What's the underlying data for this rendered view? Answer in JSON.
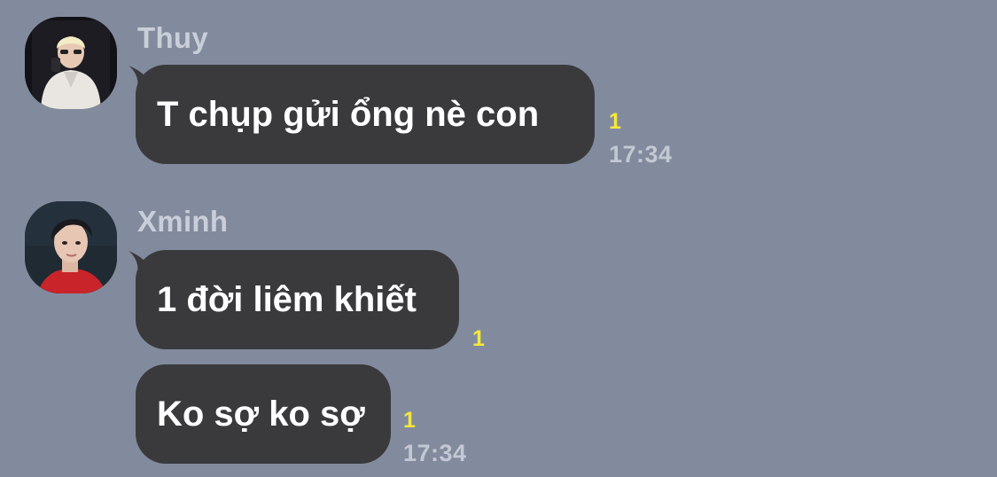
{
  "theme": {
    "background": "#828b9d",
    "bubble": "#3a3a3d",
    "unread_color": "#f4e83a"
  },
  "messages": [
    {
      "sender": "Thuy",
      "avatar_icon": "person-photo-avatar",
      "items": [
        {
          "text": "T chụp gửi ổng nè con",
          "unread": "1",
          "time": "17:34"
        }
      ]
    },
    {
      "sender": "Xminh",
      "avatar_icon": "person-photo-avatar",
      "items": [
        {
          "text": "1 đời liêm khiết",
          "unread": "1",
          "time": ""
        },
        {
          "text": "Ko sợ ko sợ",
          "unread": "1",
          "time": "17:34"
        }
      ]
    }
  ]
}
